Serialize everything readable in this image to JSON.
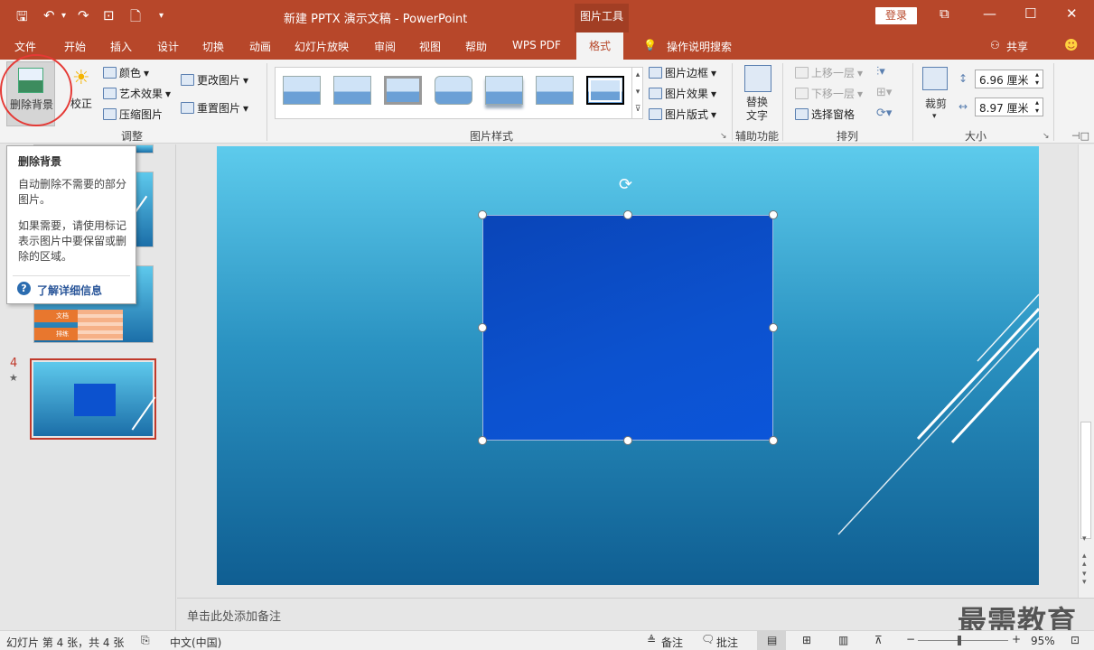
{
  "window": {
    "title": "新建 PPTX 演示文稿  -  PowerPoint",
    "context_tab": "图片工具",
    "login_label": "登录",
    "share_label": "共享"
  },
  "tabs": [
    "文件",
    "开始",
    "插入",
    "设计",
    "切换",
    "动画",
    "幻灯片放映",
    "审阅",
    "视图",
    "帮助",
    "WPS PDF",
    "格式",
    "操作说明搜索"
  ],
  "active_tab": "格式",
  "ribbon": {
    "adjust": {
      "remove_bg": "删除背景",
      "correct": "校正",
      "color": "颜色",
      "artistic": "艺术效果",
      "compress": "压缩图片",
      "change": "更改图片",
      "reset": "重置图片",
      "label": "调整"
    },
    "styles": {
      "border": "图片边框",
      "effects": "图片效果",
      "layout": "图片版式",
      "label": "图片样式"
    },
    "accessibility": {
      "alt_text_line1": "替换",
      "alt_text_line2": "文字",
      "label": "辅助功能"
    },
    "arrange": {
      "bring_forward": "上移一层",
      "send_backward": "下移一层",
      "selection_pane": "选择窗格",
      "label": "排列"
    },
    "size": {
      "crop": "裁剪",
      "height": "6.96 厘米",
      "width": "8.97 厘米",
      "label": "大小"
    }
  },
  "tooltip": {
    "title": "删除背景",
    "line1": "自动删除不需要的部分",
    "line2": "图片。",
    "line3": "如果需要，请使用标记",
    "line4": "表示图片中要保留或删",
    "line5": "除的区域。",
    "link": "了解详细信息"
  },
  "slides_pane": {
    "current_number": "4",
    "star": "★",
    "table_cell1": "文档",
    "table_cell2": "排练"
  },
  "notes_placeholder": "单击此处添加备注",
  "status": {
    "slide_info": "幻灯片 第 4 张，共 4 张",
    "language": "中文(中国)",
    "notes": "备注",
    "comments": "批注",
    "zoom": "95%"
  },
  "watermark": "最需教育",
  "colors": {
    "accent": "#b7472a",
    "slide_top": "#5dcbec",
    "slide_bottom": "#0f5e92",
    "picture": "#0c52cf"
  }
}
